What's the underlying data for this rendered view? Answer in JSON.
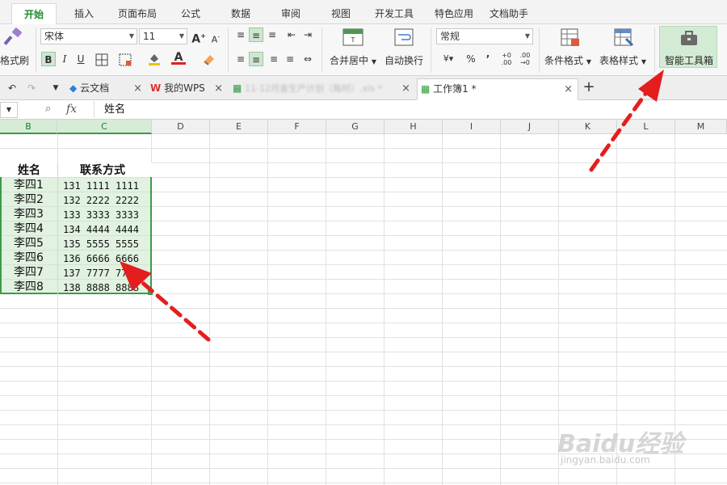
{
  "menu": {
    "tabs": [
      "开始",
      "插入",
      "页面布局",
      "公式",
      "数据",
      "审阅",
      "视图",
      "开发工具",
      "特色应用",
      "文档助手"
    ]
  },
  "ribbon": {
    "format_painter": "格式刷",
    "font_name": "宋体",
    "font_size": "11",
    "bold": "B",
    "italic": "I",
    "underline": "U",
    "merge_center": "合并居中",
    "wrap_text": "自动换行",
    "number_format": "常规",
    "percent": "%",
    "comma": "’",
    "cond_format": "条件格式",
    "table_style": "表格样式",
    "smart_toolbox": "智能工具箱"
  },
  "doc_tabs": {
    "cloud_docs": "云文档",
    "my_wps": "我的WPS",
    "blurred_file": "11-12月查生产计划（每时）.xls *",
    "workbook": "工作簿1 *",
    "add": "+"
  },
  "formula_bar": {
    "fx": "fx",
    "content": "姓名"
  },
  "columns": [
    "B",
    "C",
    "D",
    "E",
    "F",
    "G",
    "H",
    "I",
    "J",
    "K",
    "L",
    "M"
  ],
  "table": {
    "headers": [
      "姓名",
      "联系方式"
    ],
    "rows": [
      [
        "李四1",
        "131 1111 1111"
      ],
      [
        "李四2",
        "132 2222 2222"
      ],
      [
        "李四3",
        "133 3333 3333"
      ],
      [
        "李四4",
        "134 4444 4444"
      ],
      [
        "李四5",
        "135 5555 5555"
      ],
      [
        "李四6",
        "136 6666 6666"
      ],
      [
        "李四7",
        "137 7777 7777"
      ],
      [
        "李四8",
        "138 8888 8888"
      ]
    ]
  },
  "watermark": {
    "brand": "Baidu经验",
    "url": "jingyan.baidu.com"
  },
  "colors": {
    "accent_green": "#1a8a2e",
    "selection_border": "#3d9a4a",
    "arrow_red": "#e41e1e"
  }
}
